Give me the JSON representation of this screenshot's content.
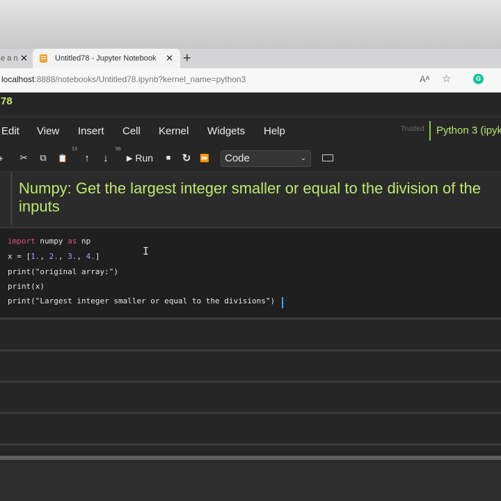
{
  "browser": {
    "tabs": [
      {
        "label": "e a n",
        "close": "✕"
      },
      {
        "label": "Untitled78 - Jupyter Notebook",
        "close": "✕"
      }
    ],
    "new_tab": "+",
    "url_host": "localhost",
    "url_rest": ":8888/notebooks/Untitled78.ipynb?kernel_name=python3",
    "read_aloud": "Aᴬ",
    "favorite": "☆",
    "grammarly": "G"
  },
  "notebook": {
    "title": "78",
    "menu": [
      "Edit",
      "View",
      "Insert",
      "Cell",
      "Kernel",
      "Widgets",
      "Help"
    ],
    "trusted": "Trusted",
    "kernel": "Python 3 (ipyk",
    "toolbar": {
      "add": "+",
      "cut": "✂",
      "copy": "⧉",
      "paste": "📋",
      "paste_sup": "13",
      "move_up": "↑",
      "move_down": "↓",
      "move_sup": "56",
      "run_label": "Run",
      "stop": "■",
      "restart": "↻",
      "fast_forward": "⏩",
      "cell_type": "Code"
    },
    "markdown_text": "Numpy: Get the largest integer smaller or equal to the division of the inputs",
    "code": {
      "l1_kw1": "import",
      "l1_mod": " numpy ",
      "l1_kw2": "as",
      "l1_alias": " np",
      "l2_a": "x = [",
      "l2_n1": "1.",
      "l2_b": ", ",
      "l2_n2": "2.",
      "l2_c": ", ",
      "l2_n3": "3.",
      "l2_d": ", ",
      "l2_n4": "4.",
      "l2_e": "]",
      "l3": "print(\"original array:\")",
      "l4": "print(x)",
      "l5": "print(\"Largest integer smaller or equal to the divisions\")"
    },
    "ibeam": "I"
  }
}
